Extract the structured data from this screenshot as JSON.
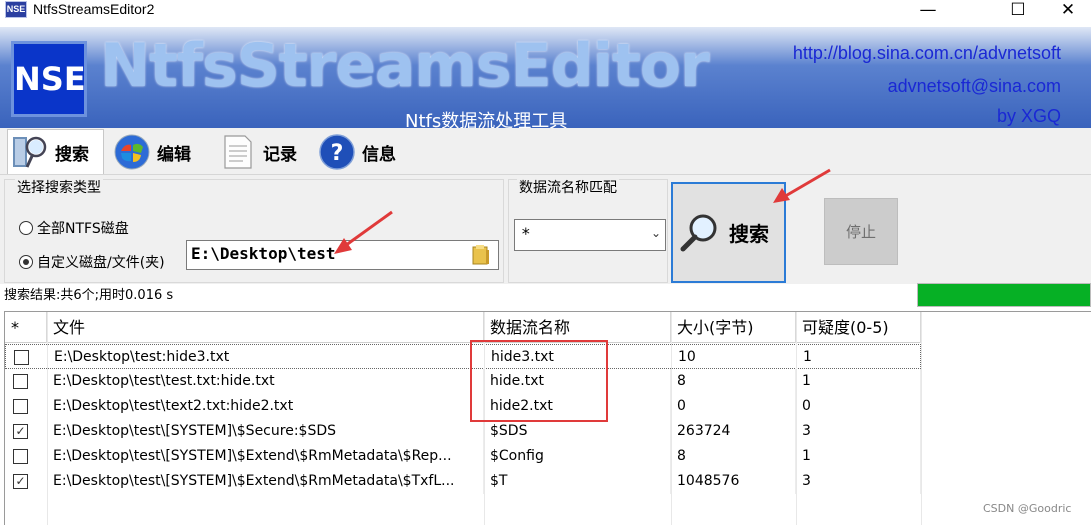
{
  "window": {
    "title": "NtfsStreamsEditor2",
    "icon_text": "NSE",
    "controls": {
      "minimize": "—",
      "maximize": "☐",
      "close": "✕"
    }
  },
  "banner": {
    "logo_text": "NSE",
    "title": "NtfsStreamsEditor",
    "subtitle": "Ntfs数据流处理工具",
    "links": [
      "http://blog.sina.com.cn/advnetsoft",
      "advnetsoft@sina.com",
      "by XGQ"
    ]
  },
  "tabs": [
    {
      "label": "搜索",
      "icon": "search-person-icon",
      "active": true
    },
    {
      "label": "编辑",
      "icon": "windows-orb-icon",
      "active": false
    },
    {
      "label": "记录",
      "icon": "document-icon",
      "active": false
    },
    {
      "label": "信息",
      "icon": "help-icon",
      "active": false
    }
  ],
  "search_panel": {
    "type_group_label": "选择搜索类型",
    "option_all": "全部NTFS磁盘",
    "option_custom": "自定义磁盘/文件(夹)",
    "selected_option": "custom",
    "path_value": "E:\\Desktop\\test",
    "name_group_label": "数据流名称匹配",
    "name_pattern": "*",
    "search_button": "搜索",
    "stop_button": "停止"
  },
  "status": {
    "text": "搜索结果:共6个;用时0.016 s",
    "progress": 1.0
  },
  "table": {
    "columns": [
      "*",
      "文件",
      "数据流名称",
      "大小(字节)",
      "可疑度(0-5)"
    ],
    "rows": [
      {
        "checked": false,
        "file": "E:\\Desktop\\test:hide3.txt",
        "stream": "hide3.txt",
        "size": "10",
        "suspicion": "1"
      },
      {
        "checked": false,
        "file": "E:\\Desktop\\test\\test.txt:hide.txt",
        "stream": "hide.txt",
        "size": "8",
        "suspicion": "1"
      },
      {
        "checked": false,
        "file": "E:\\Desktop\\test\\text2.txt:hide2.txt",
        "stream": "hide2.txt",
        "size": "0",
        "suspicion": "0"
      },
      {
        "checked": true,
        "file": "E:\\Desktop\\test\\[SYSTEM]\\$Secure:$SDS",
        "stream": "$SDS",
        "size": "263724",
        "suspicion": "3"
      },
      {
        "checked": false,
        "file": "E:\\Desktop\\test\\[SYSTEM]\\$Extend\\$RmMetadata\\$Rep...",
        "stream": "$Config",
        "size": "8",
        "suspicion": "1"
      },
      {
        "checked": true,
        "file": "E:\\Desktop\\test\\[SYSTEM]\\$Extend\\$RmMetadata\\$TxfL...",
        "stream": "$T",
        "size": "1048576",
        "suspicion": "3"
      }
    ]
  },
  "watermark": "CSDN @Goodric",
  "colors": {
    "accent": "#2b7bd6",
    "progress": "#06b025",
    "annotation": "#e03a3a",
    "banner": "#3a63bc"
  }
}
